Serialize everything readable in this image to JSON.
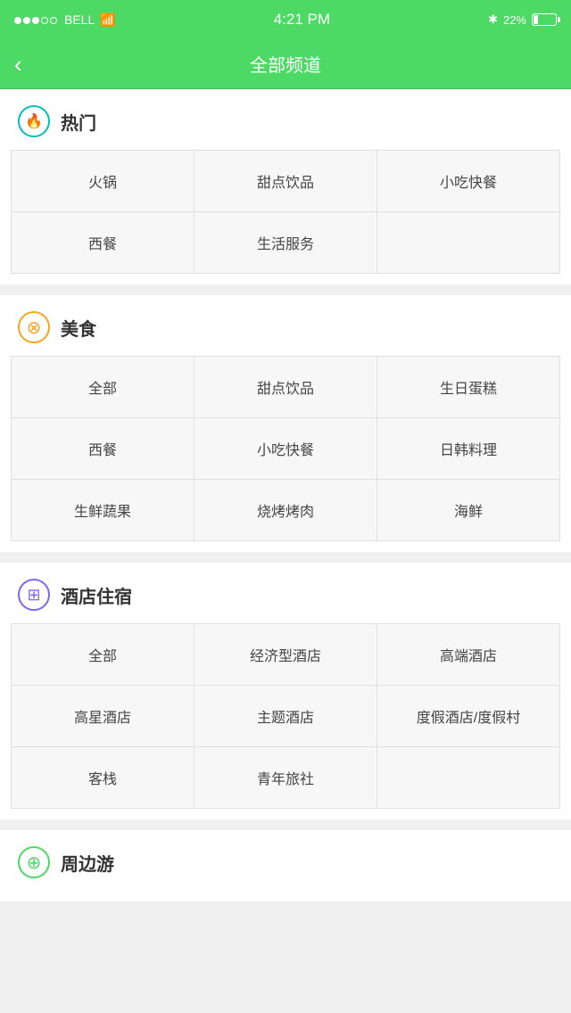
{
  "statusBar": {
    "carrier": "BELL",
    "time": "4:21 PM",
    "battery": "22%"
  },
  "navBar": {
    "backLabel": "‹",
    "title": "全部频道"
  },
  "sections": [
    {
      "id": "hot",
      "iconType": "hot",
      "iconSymbol": "🔥",
      "title": "热门",
      "items": [
        "火锅",
        "甜点饮品",
        "小吃快餐",
        "西餐",
        "生活服务"
      ]
    },
    {
      "id": "food",
      "iconType": "food",
      "iconSymbol": "✕",
      "title": "美食",
      "items": [
        "全部",
        "甜点饮品",
        "生日蛋糕",
        "西餐",
        "小吃快餐",
        "日韩料理",
        "生鲜蔬果",
        "烧烤烤肉",
        "海鲜"
      ]
    },
    {
      "id": "hotel",
      "iconType": "hotel",
      "iconSymbol": "⊞",
      "title": "酒店住宿",
      "items": [
        "全部",
        "经济型酒店",
        "高端酒店",
        "高星酒店",
        "主题酒店",
        "度假酒店/度假村",
        "客栈",
        "青年旅社"
      ]
    },
    {
      "id": "nearby",
      "iconType": "nearby",
      "iconSymbol": "⊕",
      "title": "周边游",
      "items": []
    }
  ]
}
